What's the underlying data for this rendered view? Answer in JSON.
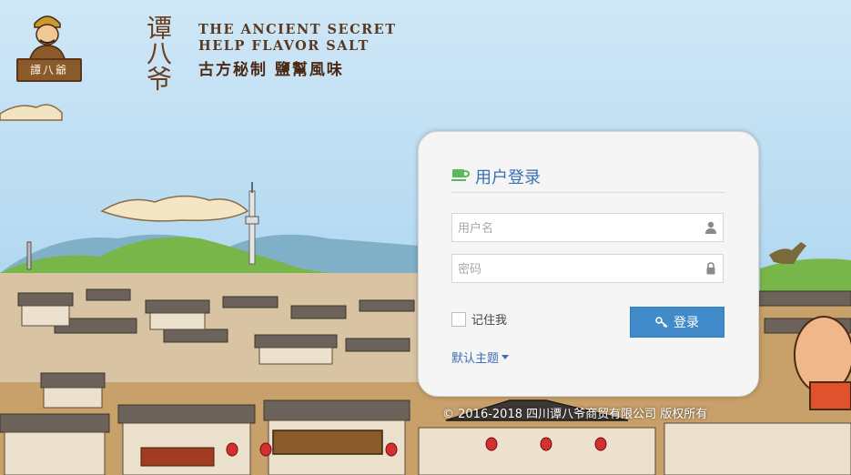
{
  "branding": {
    "avatar_plate": "譚八爺",
    "brand_vertical": "谭八爷",
    "tagline_en_line1": "THE ANCIENT SECRET",
    "tagline_en_line2": "HELP FLAVOR SALT",
    "tagline_cn": "古方秘制 鹽幫風味"
  },
  "login": {
    "title": "用户登录",
    "username_placeholder": "用户名",
    "password_placeholder": "密码",
    "remember_label": "记住我",
    "submit_label": "登录",
    "theme_label": "默认主题"
  },
  "footer": {
    "copyright": "© 2016-2018 四川谭八爷商贸有限公司 版权所有"
  },
  "icons": {
    "title": "coffee-cup-icon",
    "username": "user-icon",
    "password": "lock-icon",
    "submit": "key-icon",
    "theme": "caret-down-icon"
  },
  "colors": {
    "accent": "#428bca",
    "title_text": "#3a6fb0",
    "cup_icon": "#5cb85c"
  }
}
